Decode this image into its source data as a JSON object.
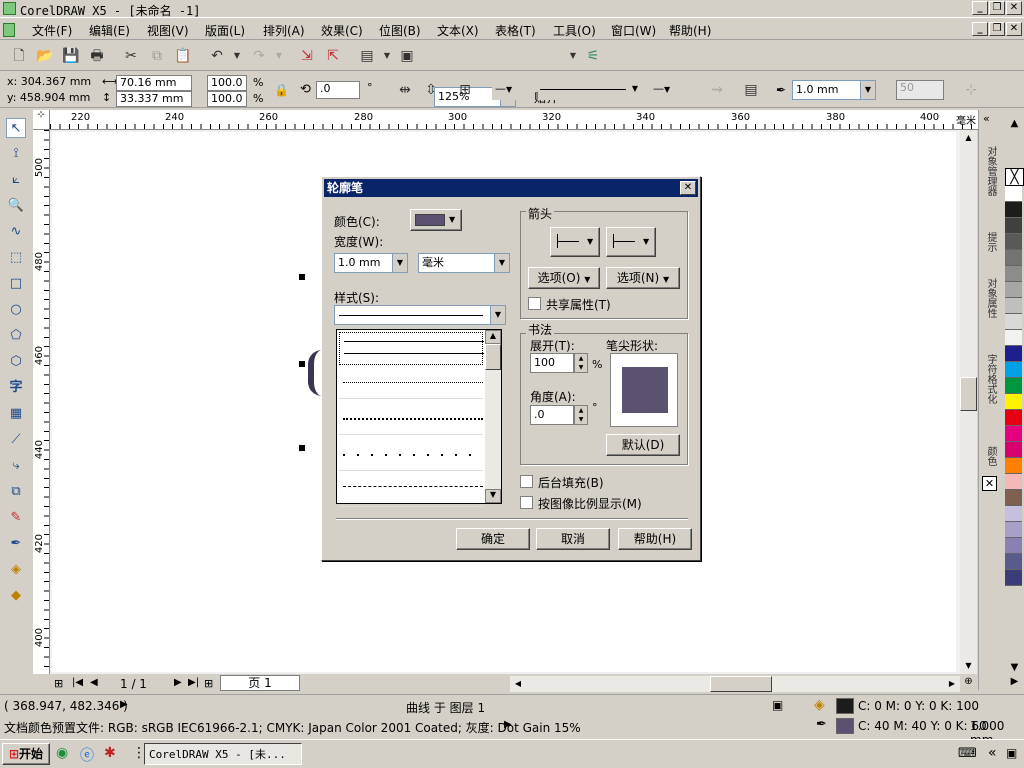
{
  "titlebar": {
    "title": "CorelDRAW X5 - [未命名 -1]"
  },
  "menu": {
    "items": [
      "文件(F)",
      "编辑(E)",
      "视图(V)",
      "版面(L)",
      "排列(A)",
      "效果(C)",
      "位图(B)",
      "文本(X)",
      "表格(T)",
      "工具(O)",
      "窗口(W)",
      "帮助(H)"
    ]
  },
  "toolbar": {
    "zoom": "125%",
    "snap_label": "贴齐"
  },
  "propbar": {
    "x": "x: 304.367 mm",
    "y": "y: 458.904 mm",
    "w": "70.16 mm",
    "h": "33.337 mm",
    "sx": "100.0",
    "sy": "100.0",
    "pct": "%",
    "angle": ".0",
    "deg": "°",
    "outline_width": "1.0 mm",
    "opacity": "50"
  },
  "ruler_h": [
    "220",
    "240",
    "260",
    "280",
    "300",
    "320",
    "340",
    "360",
    "380",
    "400",
    "毫米"
  ],
  "ruler_v": [
    "500",
    "480",
    "460",
    "440",
    "420",
    "400"
  ],
  "pager": {
    "page_count": "1 / 1",
    "page_tab": "页 1"
  },
  "docker": {
    "tabs": [
      "对象管理器",
      "提示",
      "对象属性",
      "字符格式化",
      "颜色"
    ]
  },
  "palette": [
    "#ffffff",
    "#1c1c1c",
    "#404040",
    "#595959",
    "#737373",
    "#8c8c8c",
    "#a6a6a6",
    "#bfbfbf",
    "#d9d9d9",
    "#f2f2f2",
    "#1e1e8c",
    "#00a0e6",
    "#009640",
    "#fff200",
    "#e60012",
    "#e5007f",
    "#d6006e",
    "#ff7f00",
    "#f5b7b7",
    "#7f5f4f",
    "#c6c0dc",
    "#a8a0c8",
    "#8a80b4",
    "#5a5a8c",
    "#3c3c78"
  ],
  "status": {
    "coords": "( 368.947, 482.346 )",
    "object": "曲线 于 图层 1",
    "profile": "文档颜色预置文件: RGB: sRGB IEC61966-2.1; CMYK: Japan Color 2001 Coated; 灰度: Dot Gain 15%",
    "fill_color": "C: 0 M: 0 Y: 0 K: 100",
    "outline_color": "C: 40 M: 40 Y: 0 K: 60",
    "outline_width": "1.000 mm"
  },
  "taskbar": {
    "start": "开始",
    "task": "CorelDRAW X5 - [未..."
  },
  "dialog": {
    "title": "轮廓笔",
    "color_label": "颜色(C):",
    "width_label": "宽度(W):",
    "width_value": "1.0 mm",
    "unit_value": "毫米",
    "style_label": "样式(S):",
    "arrows_group": "箭头",
    "options1": "选项(O)",
    "options2": "选项(N)",
    "share_attr": "共享属性(T)",
    "calligraphy_group": "书法",
    "stretch_label": "展开(T):",
    "stretch_value": "100",
    "stretch_unit": "%",
    "angle_label": "角度(A):",
    "angle_value": ".0",
    "angle_unit": "°",
    "nib_label": "笔尖形状:",
    "default_btn": "默认(D)",
    "behind_fill": "后台填充(B)",
    "scale_with_image": "按图像比例显示(M)",
    "ok": "确定",
    "cancel": "取消",
    "help": "帮助(H)",
    "pen_color": "#5a5270"
  }
}
